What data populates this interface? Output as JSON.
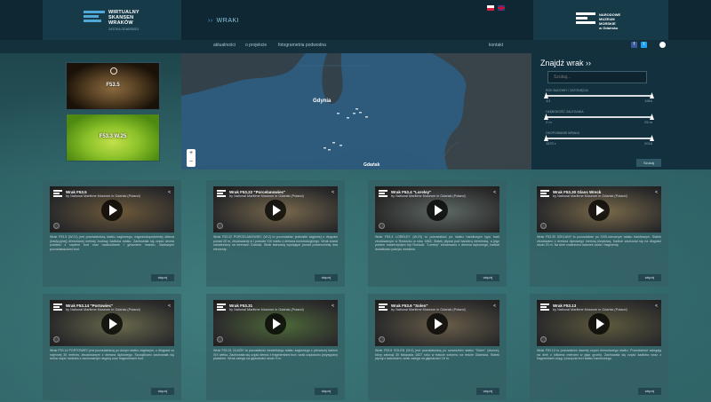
{
  "header": {
    "brand_lines": [
      "WIRTUALNY",
      "SKANSEN",
      "WRAKÓW"
    ],
    "brand_sub": "ZATOKA GDAŃSKIEJ",
    "section_title": "WRAKI",
    "museum_lines": [
      "NARODOWE",
      "MUZEUM",
      "MORSKIE",
      "w Gdańsku"
    ],
    "languages": [
      "pl",
      "en"
    ]
  },
  "nav": {
    "items": [
      "aktualności",
      "o projekcie",
      "fotogrametria podwodna",
      "kontakt"
    ]
  },
  "gallery": {
    "thumbs": [
      "F53.5",
      "F53.3 W.25"
    ]
  },
  "map": {
    "labels": [
      "Gdynia",
      "Gdańsk"
    ],
    "zoom_in": "+",
    "zoom_out": "−"
  },
  "search": {
    "title": "Znajdź wrak ››",
    "placeholder": "Szukaj...",
    "sliders": [
      {
        "label": "ROK BUDOWY / ZATONIĘCIA",
        "min": "1/1",
        "max": "1963"
      },
      {
        "label": "GŁĘBOKOŚĆ ZALEGANIA",
        "min": "2 m",
        "max": "25 m"
      },
      {
        "label": "OKOPOWANIE WRAKA",
        "min": "1870 r.",
        "max": "2016"
      }
    ],
    "button": "Szukaj"
  },
  "cards": [
    {
      "title": "Wrak F53.5",
      "subtitle": "by National Maritime Museum in Gdańsk (Poland)",
      "thumb": "#6e5a3a",
      "desc": "Wrak F53.5 (W.21) jest pozostałością statku żaglowego, najprawdopodobniej ołtarza (tradycyjnej) drewnianej metody budowy kadłuba statku. Zachowała się część denna pokładu z rzędem burt oraz nadbudówek i gniazdem masztu, śladowymi pozostałościami burt.",
      "more": "więcej"
    },
    {
      "title": "Wrak F53.22 \"Porcelanowiec\"",
      "subtitle": "by National Maritime Museum in Gdańsk (Poland)",
      "thumb": "#7a6a4e",
      "desc": "Wrak F53.22 PORCELANOWIEC (W.2) to pozostałość jednostki żaglowej o długości ponad 25 m, zbudowanej w I połowie XIX wieku z drewna konstrukcyjnego. Wrak został odnaleziony na terenach Gdańsk. Wrak stanowią wystające ponad powierzchnię dna elementy.",
      "more": "więcej"
    },
    {
      "title": "Wrak F53.4 \"Loreley\"",
      "subtitle": "by National Maritime Museum in Gdańsk (Poland)",
      "thumb": "#5e6a66",
      "desc": "Wrak F53.4 LORELEY (W.23) to pozostałość po statku handlowym typu bark zbudowanym w Rostocku w roku 1863. Statek pływał pod banderą niemiecką, a jego portem macierzystym był Rostock. \"Loreley\" zbudowano z drewna dębowego, kadłub dodatkowo pokryto metalem.",
      "more": "więcej"
    },
    {
      "title": "Wrak F53.30 Glass Wreck",
      "subtitle": "by National Maritime Museum in Gdańsk (Poland)",
      "thumb": "#7a6a4a",
      "desc": "Wrak F53.30 SZKLANY to pozostałość po XVIII-wiecznym statku handlowym. Statek zbudowano z drewna dębowego metodą klepkową. Kadłub zachował się na długości około 20 m. Na dnie znaleziono ładunek szkła i fragmenty.",
      "more": "więcej"
    },
    {
      "title": "Wrak F53.14 \"Portowiec\"",
      "subtitle": "by National Maritime Museum in Gdańsk (Poland)",
      "thumb": "#6a6a4e",
      "desc": "Wrak F53.14 PORTOWIEC jest pozostałością po dużym statku żaglowym, o długości co najmniej 30 metrów, zbudowanym z drewna dębowego. Szczątkowo zachowała się dolna część kadłuba z zachowanym stępką oraz fragmentami burt.",
      "more": "więcej"
    },
    {
      "title": "Wrak F53.31",
      "subtitle": "by National Maritime Museum in Gdańsk (Poland)",
      "thumb": "#4e6a3a",
      "desc": "Wrak F53.31 GLAZIK to pozostałość niewielkiego statku żaglowego z pierwszej ćwierci XIX wieku. Zachowała się część denna z fragmentami burt, wrak częściowo przysypany piaskiem. Wrak zalega na głębokości około 9 m.",
      "more": "więcej"
    },
    {
      "title": "Wrak F53.6 \"Solen\"",
      "subtitle": "by National Maritime Museum in Gdańsk (Poland)",
      "thumb": "#6a5e4a",
      "desc": "Wrak F53.6 SOLEN (W.4) jest pozostałością po szwedzkim statku \"Solen\" (słońce), który zatonął 30 listopada 1827 roku w trakcie sztormu na redzie Gdańska. Statek płynął z ładunkiem, wrak zalega na głębokości 16 m.",
      "more": "więcej"
    },
    {
      "title": "Wrak F53.13",
      "subtitle": "by National Maritime Museum in Gdańsk (Poland)",
      "thumb": "#5e5a3e",
      "desc": "Wrak F53.13 to pozostałość dawnej części drewnianego statku. Pozostałości zalegają na dnie z kilkoma metrami w głąb gruntu. Zachowała się część kadłuba wraz z fragmentami wręg i poszycia burt statku handlowego.",
      "more": "więcej"
    }
  ]
}
